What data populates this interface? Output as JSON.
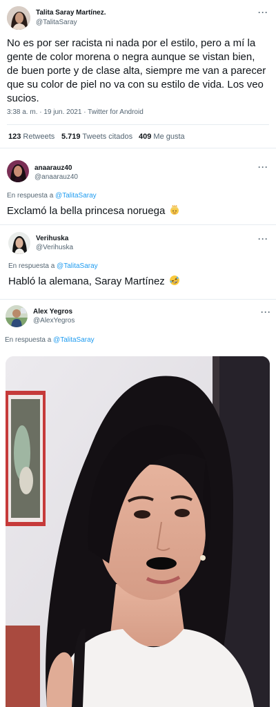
{
  "main_tweet": {
    "name": "Talita Saray Martínez.",
    "handle": "@TalitaSaray",
    "text": "No es por ser racista ni nada por el estilo, pero a mí la gente de color morena o negra aunque se vistan bien, de buen porte y de clase alta, siempre me van a parecer que su color de piel no va con su estilo de vida. Los veo sucios.",
    "time": "3:38 a. m.",
    "date": "19 jun. 2021",
    "source": "Twitter for Android",
    "separator": "·",
    "stats": {
      "retweets_count": "123",
      "retweets_label": "Retweets",
      "quotes_count": "5.719",
      "quotes_label": "Tweets citados",
      "likes_count": "409",
      "likes_label": "Me gusta"
    }
  },
  "replies": [
    {
      "name": "anaarauz40",
      "handle": "@anaarauz40",
      "reply_prefix": "En respuesta a",
      "reply_mention": "@TalitaSaray",
      "text": "Exclamó la bella princesa noruega",
      "emoji": "princess-emoji"
    },
    {
      "name": "Verihuska",
      "handle": "@Verihuska",
      "reply_prefix": "En respuesta a",
      "reply_mention": "@TalitaSaray",
      "text": "Habló la alemana, Saray Martínez",
      "emoji": "rolling-on-floor-laughing-emoji"
    },
    {
      "name": "Alex Yegros",
      "handle": "@AlexYegros",
      "reply_prefix": "En respuesta a",
      "reply_mention": "@TalitaSaray",
      "media": "photo"
    }
  ],
  "colors": {
    "text": "#0f1419",
    "secondary": "#536471",
    "link": "#1d9bf0",
    "divider": "#e6ecf0"
  },
  "icons": {
    "more": "more-options-icon"
  }
}
